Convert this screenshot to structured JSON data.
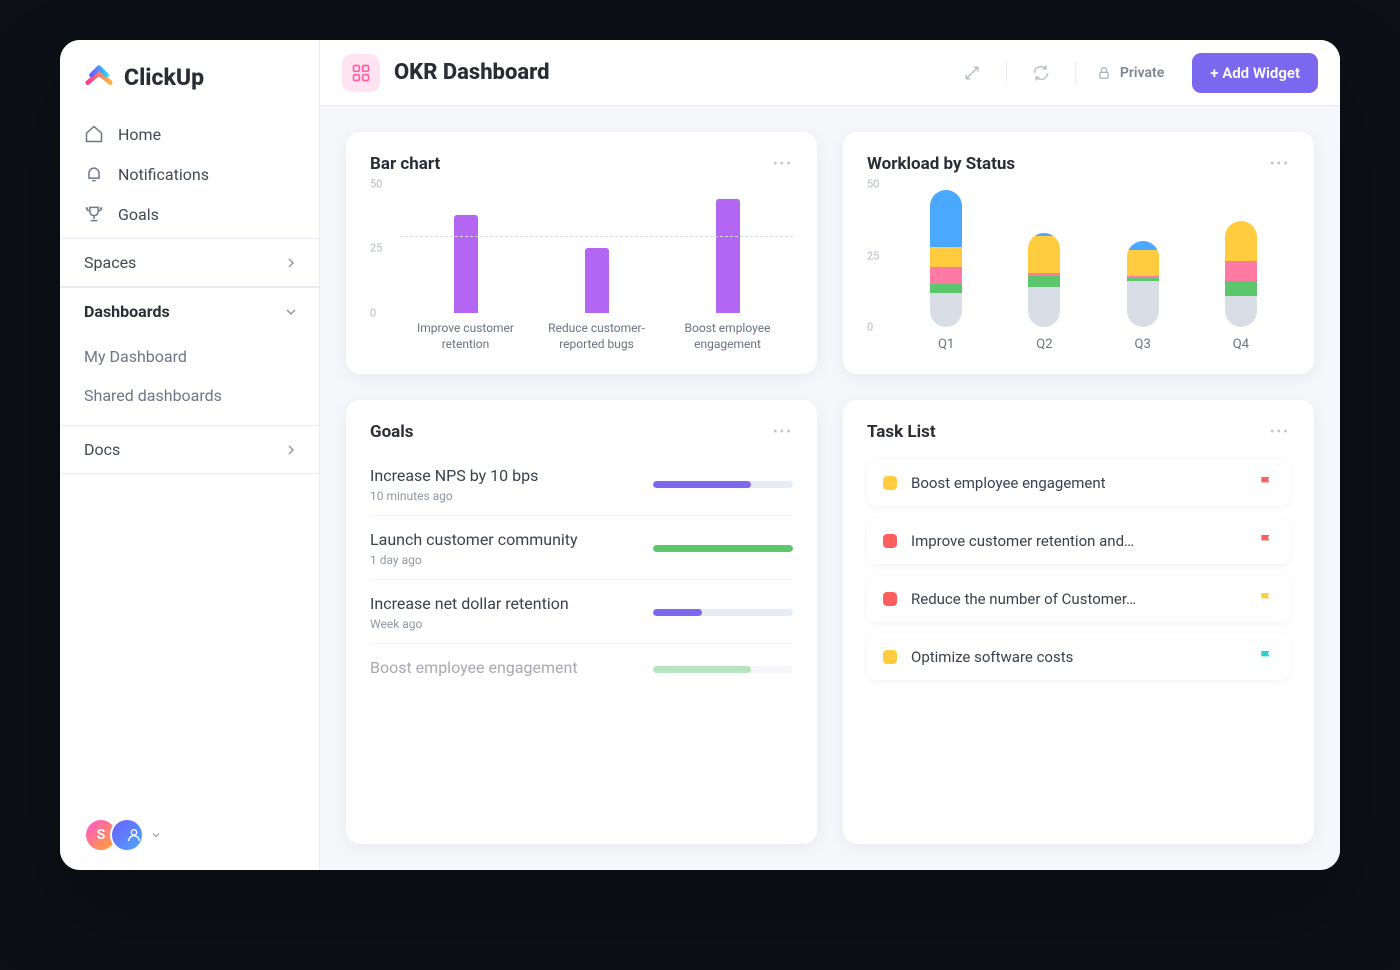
{
  "brand": "ClickUp",
  "sidebar": {
    "nav": [
      {
        "label": "Home",
        "icon": "home"
      },
      {
        "label": "Notifications",
        "icon": "bell"
      },
      {
        "label": "Goals",
        "icon": "trophy"
      }
    ],
    "spaces_label": "Spaces",
    "dashboards_label": "Dashboards",
    "dashboards_items": [
      {
        "label": "My Dashboard"
      },
      {
        "label": "Shared dashboards"
      }
    ],
    "docs_label": "Docs",
    "avatar_letter": "S"
  },
  "header": {
    "title": "OKR Dashboard",
    "private_label": "Private",
    "add_widget_label": "+ Add Widget"
  },
  "widgets": {
    "bar": {
      "title": "Bar chart"
    },
    "workload": {
      "title": "Workload by Status"
    },
    "goals": {
      "title": "Goals",
      "items": [
        {
          "title": "Increase NPS by 10 bps",
          "time": "10 minutes ago",
          "pct": 70,
          "color": "#7b68ee"
        },
        {
          "title": "Launch customer community",
          "time": "1 day ago",
          "pct": 100,
          "color": "#5bc66c"
        },
        {
          "title": "Increase net dollar retention",
          "time": "Week ago",
          "pct": 35,
          "color": "#7b68ee"
        },
        {
          "title": "Boost employee engagement",
          "time": "",
          "pct": 70,
          "color": "#5bc66c"
        }
      ]
    },
    "tasks": {
      "title": "Task List",
      "items": [
        {
          "label": "Boost employee engagement",
          "sq": "#ffcc3f",
          "flag": "#ff5e5e"
        },
        {
          "label": "Improve customer retention and…",
          "sq": "#ff5e5e",
          "flag": "#ff5e5e"
        },
        {
          "label": "Reduce the number of Customer…",
          "sq": "#ff5e5e",
          "flag": "#ffcc3f"
        },
        {
          "label": "Optimize software costs",
          "sq": "#ffcc3f",
          "flag": "#2cd0d0"
        }
      ]
    }
  },
  "chart_data": [
    {
      "id": "bar_chart",
      "type": "bar",
      "title": "Bar chart",
      "ylim": [
        0,
        50
      ],
      "yticks": [
        0,
        25,
        50
      ],
      "reference_line": 30,
      "categories": [
        "Improve customer retention",
        "Reduce customer-reported bugs",
        "Boost employee engagement"
      ],
      "values": [
        38,
        25,
        44
      ]
    },
    {
      "id": "workload_by_status",
      "type": "stacked-bar",
      "title": "Workload by Status",
      "ylim": [
        0,
        50
      ],
      "yticks": [
        0,
        25,
        50
      ],
      "categories": [
        "Q1",
        "Q2",
        "Q3",
        "Q4"
      ],
      "segment_colors": [
        "#d9dde6",
        "#5bc66c",
        "#ff7aa2",
        "#ffcc3f",
        "#4aa9ff"
      ],
      "series": [
        {
          "name": "Q1",
          "values": [
            12,
            3,
            6,
            7,
            20
          ]
        },
        {
          "name": "Q2",
          "values": [
            14,
            4,
            1,
            13,
            1
          ]
        },
        {
          "name": "Q3",
          "values": [
            16,
            1,
            1,
            9,
            3
          ]
        },
        {
          "name": "Q4",
          "values": [
            11,
            5,
            7,
            14,
            0
          ]
        }
      ]
    }
  ]
}
